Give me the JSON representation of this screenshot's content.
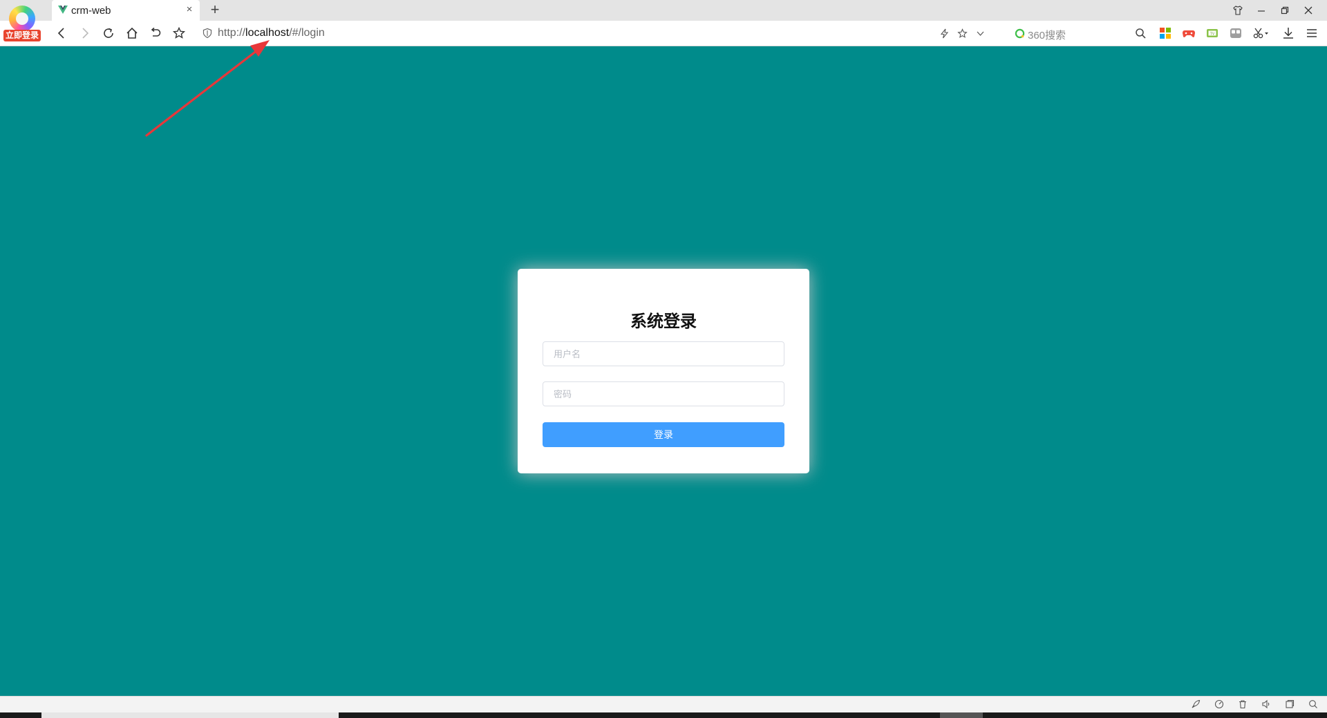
{
  "browser": {
    "brand_badge": "立即登录",
    "tab": {
      "title": "crm-web",
      "close_glyph": "×"
    },
    "new_tab_glyph": "+",
    "url": {
      "scheme": "http://",
      "host": "localhost",
      "path": "/#/login"
    },
    "search": {
      "placeholder": "360搜索"
    }
  },
  "login": {
    "title": "系统登录",
    "username_placeholder": "用户名",
    "password_placeholder": "密码",
    "submit_label": "登录"
  },
  "colors": {
    "page_background": "#008b8b",
    "primary_button": "#409eff",
    "annotation_arrow": "#e8373a",
    "brand_badge": "#e8452f"
  },
  "icons": {
    "nav": [
      "back-icon",
      "forward-icon",
      "refresh-icon",
      "home-icon",
      "undo-icon",
      "star-icon"
    ],
    "address_tools": [
      "lightning-icon",
      "favorite-icon",
      "dropdown-icon"
    ],
    "toolbar": [
      "apps-icon",
      "game-icon",
      "video-icon",
      "extension-icon",
      "scissors-icon",
      "download-icon",
      "menu-icon"
    ],
    "status": [
      "rocket-icon",
      "speed-icon",
      "trash-icon",
      "sound-icon",
      "window-icon",
      "zoom-icon"
    ]
  }
}
